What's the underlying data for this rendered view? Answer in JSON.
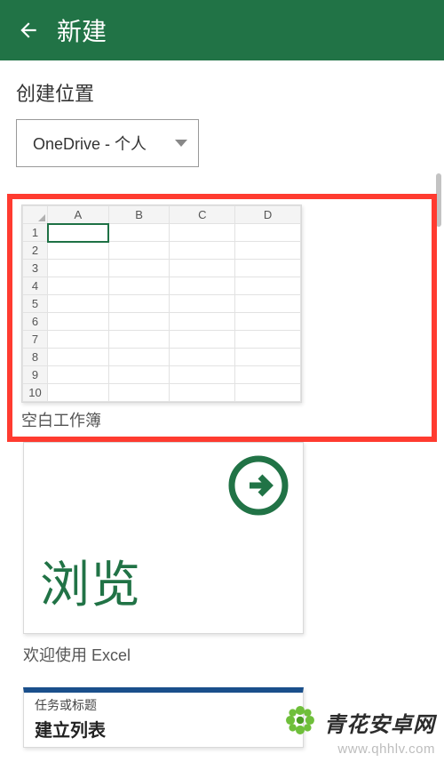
{
  "header": {
    "title": "新建"
  },
  "location": {
    "label": "创建位置",
    "selected": "OneDrive - 个人"
  },
  "templates": {
    "blank": {
      "label": "空白工作簿",
      "columns": [
        "A",
        "B",
        "C",
        "D"
      ],
      "rows": [
        "1",
        "2",
        "3",
        "4",
        "5",
        "6",
        "7",
        "8",
        "9",
        "10"
      ]
    },
    "browse": {
      "title": "浏览",
      "label": "欢迎使用 Excel"
    },
    "list": {
      "header": "任务或标题",
      "title": "建立列表"
    }
  },
  "watermark": {
    "name": "青花安卓网",
    "url": "www.qhhlv.com"
  }
}
